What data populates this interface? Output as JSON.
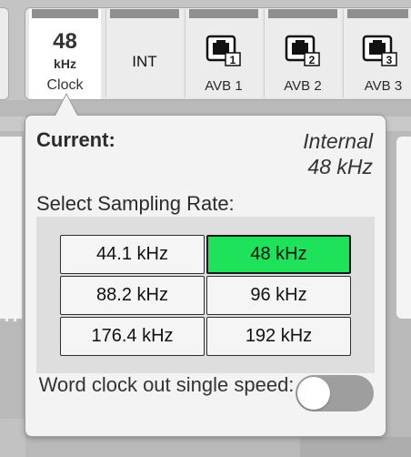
{
  "sources": {
    "clock": {
      "rate": "48",
      "unit": "kHz",
      "label": "Clock"
    },
    "int_label": "INT",
    "avb": [
      {
        "label": "AVB 1",
        "port": "1",
        "icon": "ethernet-port-icon"
      },
      {
        "label": "AVB 2",
        "port": "2",
        "icon": "ethernet-port-icon"
      },
      {
        "label": "AVB 3",
        "port": "3",
        "icon": "ethernet-port-icon"
      }
    ]
  },
  "popover": {
    "current_label": "Current:",
    "current_source": "Internal",
    "current_rate": "48 kHz",
    "select_label": "Select Sampling Rate:",
    "rates": [
      {
        "label": "44.1 kHz",
        "selected": false
      },
      {
        "label": "48 kHz",
        "selected": true
      },
      {
        "label": "88.2 kHz",
        "selected": false
      },
      {
        "label": "96 kHz",
        "selected": false
      },
      {
        "label": "176.4 kHz",
        "selected": false
      },
      {
        "label": "192 kHz",
        "selected": false
      }
    ],
    "word_clock_label": "Word clock out single speed:",
    "word_clock_on": false
  },
  "colors": {
    "selected_rate": "#1ee35a",
    "toggle_off": "#9e9e9e"
  }
}
